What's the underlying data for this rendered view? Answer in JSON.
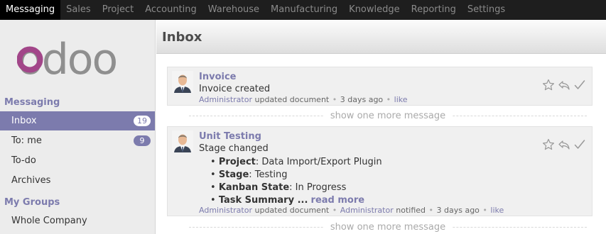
{
  "topbar": {
    "menus": [
      "Messaging",
      "Sales",
      "Project",
      "Accounting",
      "Warehouse",
      "Manufacturing",
      "Knowledge",
      "Reporting",
      "Settings"
    ]
  },
  "sidebar": {
    "logo": "odoo",
    "sections": [
      {
        "title": "Messaging",
        "items": [
          {
            "label": "Inbox",
            "count": "19",
            "active": true
          },
          {
            "label": "To: me",
            "count": "9"
          },
          {
            "label": "To-do"
          },
          {
            "label": "Archives"
          }
        ]
      },
      {
        "title": "My Groups",
        "items": [
          {
            "label": "Whole Company"
          }
        ]
      }
    ]
  },
  "main": {
    "title": "Inbox",
    "show_more": "show one more message",
    "messages": [
      {
        "title": "Invoice",
        "body": "Invoice created",
        "meta": {
          "author": "Administrator",
          "action": "updated document",
          "time": "3 days ago",
          "like": "like"
        }
      },
      {
        "title": "Unit Testing",
        "body": "Stage changed",
        "details": [
          {
            "key": "Project",
            "value": ": Data Import/Export Plugin"
          },
          {
            "key": "Stage",
            "value": ": Testing"
          },
          {
            "key": "Kanban State",
            "value": ": In Progress"
          },
          {
            "key": "Task Summary",
            "value": " ...",
            "more": "read more"
          }
        ],
        "meta": {
          "author": "Administrator",
          "action": "updated document",
          "notified": "Administrator",
          "notified_label": "notified",
          "time": "3 days ago",
          "like": "like"
        }
      }
    ]
  },
  "colors": {
    "accent": "#7c7bad",
    "topbar": "#1e1e1e",
    "sidebar": "#ececec"
  }
}
